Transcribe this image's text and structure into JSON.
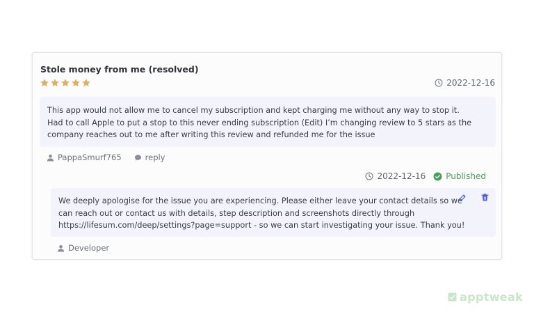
{
  "review": {
    "title": "Stole money from me (resolved)",
    "rating": 5,
    "date": "2022-12-16",
    "body_lines": [
      "This app would not allow me to cancel my subscription and kept charging me without any way to stop it.",
      "Had to call Apple to put a stop to this never ending subscription (Edit) I’m changing review to 5 stars as the",
      "company reaches out to me after writing this review and refunded me for the issue"
    ],
    "author": "PappaSmurf765",
    "reply_label": "reply"
  },
  "response": {
    "date": "2022-12-16",
    "status": "Published",
    "body_lines": [
      "We deeply apologise for the issue you are experiencing. Please either leave your contact details so we",
      "can reach out or contact us with details, step description and screenshots directly through",
      "https://lifesum.com/deep/settings?page=support - so we can start investigating your issue. Thank you!"
    ],
    "author": "Developer"
  },
  "watermark": {
    "text": "apptweak"
  },
  "colors": {
    "star": "#e2ad5b",
    "accent": "#4b5bd6",
    "published": "#4a9e5c",
    "box_bg": "#f3f4fb"
  },
  "icons": [
    "star-icon",
    "clock-icon",
    "user-icon",
    "comment-icon",
    "check-circle-icon",
    "edit-icon",
    "trash-icon",
    "apptweak-logo-icon"
  ]
}
